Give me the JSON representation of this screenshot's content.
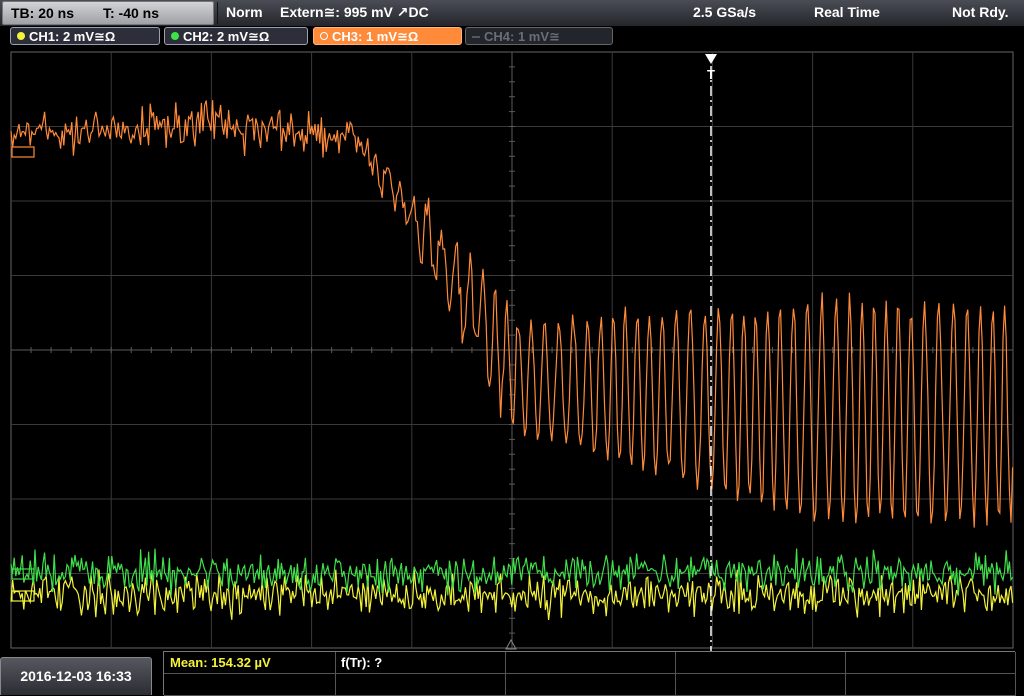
{
  "topbar": {
    "timebase": "TB: 20 ns",
    "trigger_time": "T: -40 ns",
    "trigger_mode": "Norm",
    "trigger_source": "Extern≅: 995 mV ↗DC",
    "sample_rate": "2.5 GSa/s",
    "acquisition_mode": "Real Time",
    "status": "Not Rdy."
  },
  "channels": [
    {
      "label": "CH1: 2 mV≅Ω",
      "color": "#f3f33a",
      "active": true
    },
    {
      "label": "CH2: 2 mV≅Ω",
      "color": "#3fe04a",
      "active": true
    },
    {
      "label": "CH3: 1 mV≅Ω",
      "color": "#ff8a3a",
      "active": true,
      "selected": true
    },
    {
      "label": "CH4: 1 mV≅",
      "color": "#6a6d73",
      "active": false
    }
  ],
  "trigger_marker": "T",
  "bottom": {
    "datetime": "2016-12-03 16:33",
    "measurement_1": "Mean: 154.32 µV",
    "measurement_2": "f(Tr): ?"
  },
  "colors": {
    "ch1": "#f3f33a",
    "ch2": "#3fe04a",
    "ch3": "#ff8a3a",
    "grid": "#3a3a3a",
    "grid_axis": "#5a5a5a"
  }
}
